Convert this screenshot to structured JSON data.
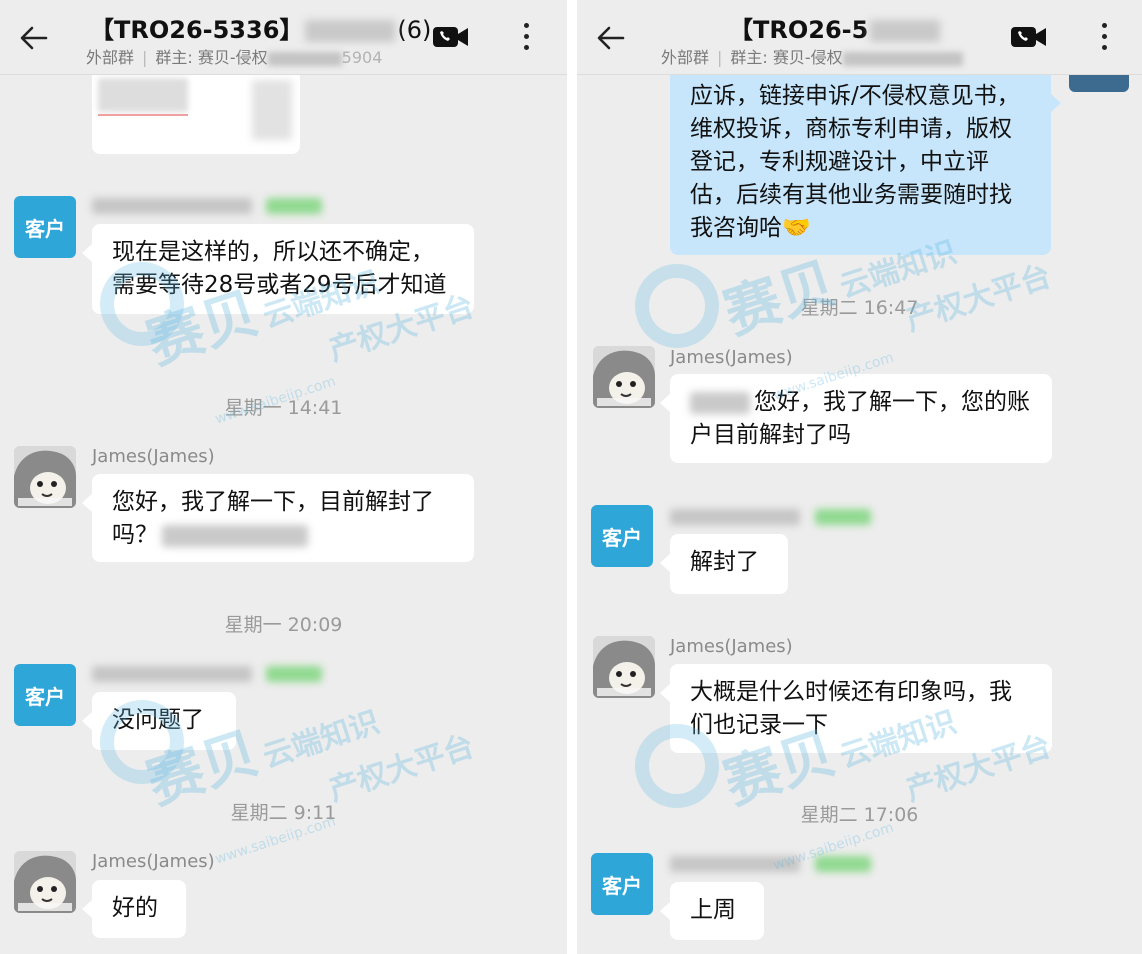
{
  "left": {
    "header": {
      "title_prefix": "【TRO26-5336】",
      "title_count": "(6)",
      "subtitle_external": "外部群",
      "subtitle_owner": "群主: 赛贝-侵权",
      "subtitle_tail": "5904"
    },
    "customer_badge": "客户",
    "messages": {
      "m1_text": "现在是这样的，所以还不确定，需要等待28号或者29号后才知道",
      "ts1": "星期一  14:41",
      "m2_sender": "James(James)",
      "m2_text": "您好，我了解一下，目前解封了吗？",
      "ts2": "星期一  20:09",
      "m3_text": "没问题了",
      "ts3": "星期二  9:11",
      "m4_sender": "James(James)",
      "m4_text": "好的"
    }
  },
  "right": {
    "header": {
      "title_prefix": "【TRO26-5",
      "subtitle_external": "外部群",
      "subtitle_owner": "群主: 赛贝-侵权"
    },
    "customer_badge": "客户",
    "messages": {
      "m0_text": "应诉，链接申诉/不侵权意见书，维权投诉，商标专利申请，版权登记，专利规避设计，中立评估，后续有其他业务需要随时找我咨询哈🤝",
      "ts1": "星期二  16:47",
      "m1_sender": "James(James)",
      "m1_text": "您好，我了解一下，您的账户目前解封了吗",
      "m2_text": "解封了",
      "m3_sender": "James(James)",
      "m3_text": "大概是什么时候还有印象吗，我们也记录一下",
      "ts2": "星期二  17:06",
      "m4_text": "上周"
    }
  },
  "watermark": {
    "brand": "赛贝",
    "line1": "云端知识",
    "line2": "产权大平台",
    "url": "www.saibeiip.com"
  },
  "icons": [
    "back-arrow-icon",
    "video-call-icon",
    "more-vertical-icon"
  ],
  "colors": {
    "customer_badge": "#2ea6d8",
    "self_bubble": "#c8e6fb",
    "background": "#ededed"
  }
}
